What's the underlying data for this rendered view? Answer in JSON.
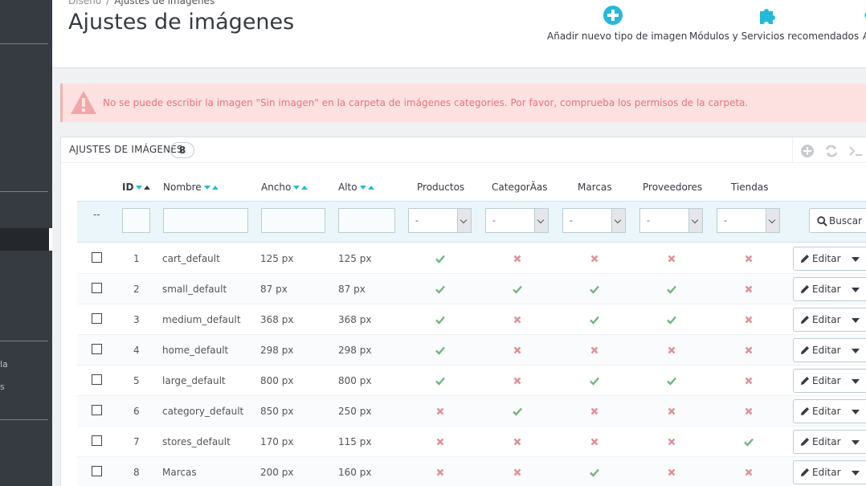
{
  "colors": {
    "accent": "#25b9d7",
    "yes": "#70b580",
    "no": "#e08f95",
    "sidebar": "#363a41"
  },
  "sidebar": {
    "frag1": "la",
    "frag2": "s"
  },
  "breadcrumb": {
    "parent": "Diseño",
    "separator": "/",
    "current": "Ajustes de imágenes"
  },
  "page_title": "Ajustes de imágenes",
  "toolbar": {
    "add_label": "Añadir nuevo tipo de imagen",
    "modules_label": "Módulos y Servicios recomendados",
    "truncated_label": "A"
  },
  "alert": {
    "message": "No se puede escribir la imagen \"Sin imagen\" en la carpeta de imágenes categories. Por favor, comprueba los permisos de la carpeta."
  },
  "panel": {
    "title": "AJUSTES DE IMÁGENES",
    "count": "8"
  },
  "columns": {
    "id": "ID",
    "name": "Nombre",
    "width": "Ancho",
    "height": "Alto",
    "products": "Productos",
    "categories": "CategorÃ­as",
    "brands": "Marcas",
    "suppliers": "Proveedores",
    "stores": "Tiendas"
  },
  "filters": {
    "dash": "--",
    "select_value": "-",
    "search_label": "Buscar"
  },
  "edit_label": "Editar",
  "rows": [
    {
      "id": "1",
      "name": "cart_default",
      "width": "125 px",
      "height": "125 px",
      "products": true,
      "categories": false,
      "brands": false,
      "suppliers": false,
      "stores": false
    },
    {
      "id": "2",
      "name": "small_default",
      "width": "87 px",
      "height": "87 px",
      "products": true,
      "categories": true,
      "brands": true,
      "suppliers": true,
      "stores": false
    },
    {
      "id": "3",
      "name": "medium_default",
      "width": "368 px",
      "height": "368 px",
      "products": true,
      "categories": false,
      "brands": true,
      "suppliers": true,
      "stores": false
    },
    {
      "id": "4",
      "name": "home_default",
      "width": "298 px",
      "height": "298 px",
      "products": true,
      "categories": false,
      "brands": false,
      "suppliers": false,
      "stores": false
    },
    {
      "id": "5",
      "name": "large_default",
      "width": "800 px",
      "height": "800 px",
      "products": true,
      "categories": false,
      "brands": true,
      "suppliers": true,
      "stores": false
    },
    {
      "id": "6",
      "name": "category_default",
      "width": "850 px",
      "height": "250 px",
      "products": false,
      "categories": true,
      "brands": false,
      "suppliers": false,
      "stores": false
    },
    {
      "id": "7",
      "name": "stores_default",
      "width": "170 px",
      "height": "115 px",
      "products": false,
      "categories": false,
      "brands": false,
      "suppliers": false,
      "stores": true
    },
    {
      "id": "8",
      "name": "Marcas",
      "width": "200 px",
      "height": "160 px",
      "products": false,
      "categories": false,
      "brands": true,
      "suppliers": false,
      "stores": false
    }
  ]
}
